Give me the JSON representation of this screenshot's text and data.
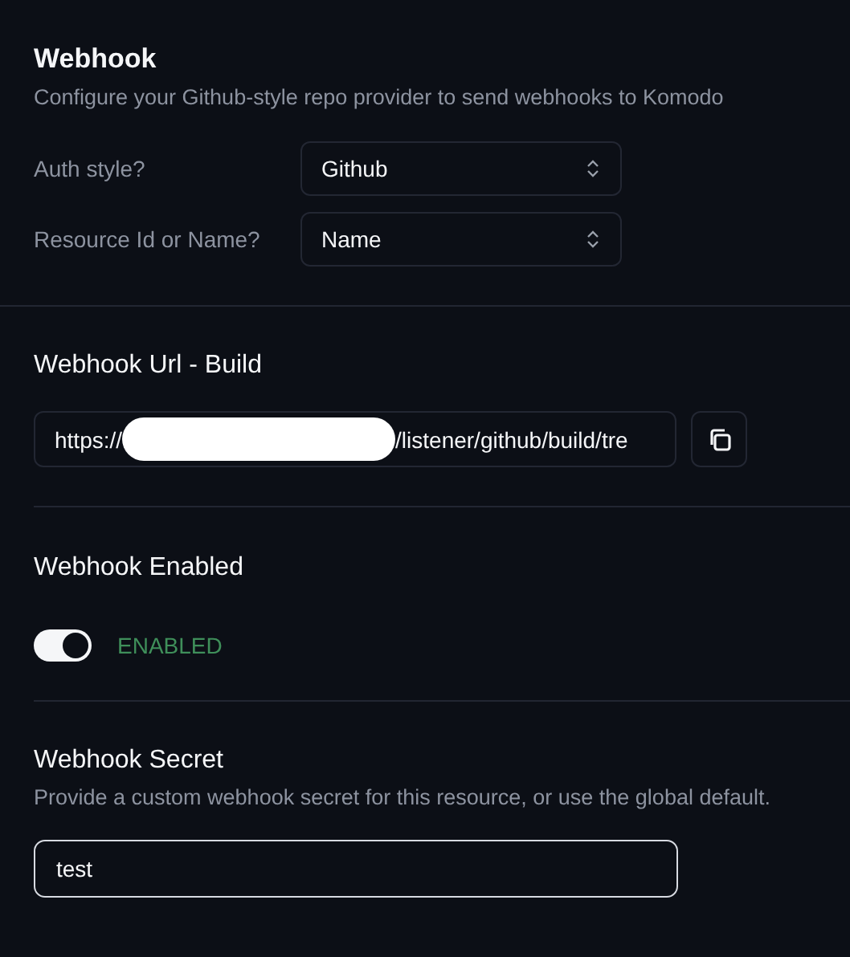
{
  "header": {
    "title": "Webhook",
    "description": "Configure your Github-style repo provider to send webhooks to Komodo"
  },
  "selects": [
    {
      "label": "Auth style?",
      "value": "Github"
    },
    {
      "label": "Resource Id or Name?",
      "value": "Name"
    }
  ],
  "webhook_url": {
    "title": "Webhook Url - Build",
    "value_start": "https://",
    "value_end": "/listener/github/build/tre"
  },
  "webhook_enabled": {
    "title": "Webhook Enabled",
    "on": true,
    "status": "ENABLED"
  },
  "webhook_secret": {
    "title": "Webhook Secret",
    "description": "Provide a custom webhook secret for this resource, or use the global default.",
    "value": "test",
    "focused": true
  }
}
